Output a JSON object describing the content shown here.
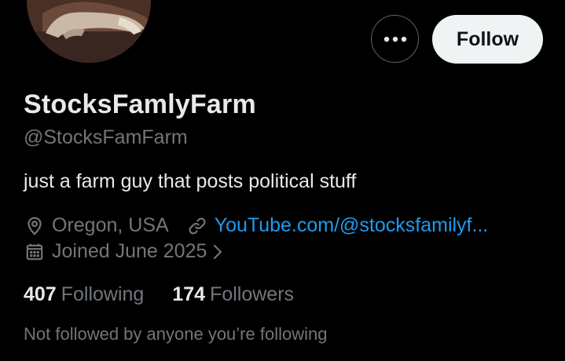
{
  "profile": {
    "display_name": "StocksFamlyFarm",
    "handle": "@StocksFamFarm",
    "bio": "just a farm guy that posts political stuff",
    "location": "Oregon, USA",
    "website": "YouTube.com/@stocksfamilyf...",
    "joined": "Joined June 2025"
  },
  "actions": {
    "more_icon": "ellipsis-icon",
    "follow_label": "Follow"
  },
  "stats": {
    "following_count": "407",
    "following_label": "Following",
    "followers_count": "174",
    "followers_label": "Followers"
  },
  "followed_by_note": "Not followed by anyone you’re following",
  "icons": {
    "location": "location-pin-icon",
    "link": "link-icon",
    "calendar": "calendar-icon",
    "chevron": "chevron-right-icon"
  },
  "colors": {
    "background": "#000000",
    "text_primary": "#e7e9ea",
    "text_secondary": "#71767b",
    "link": "#1d9bf0",
    "follow_button_bg": "#eff3f4"
  }
}
